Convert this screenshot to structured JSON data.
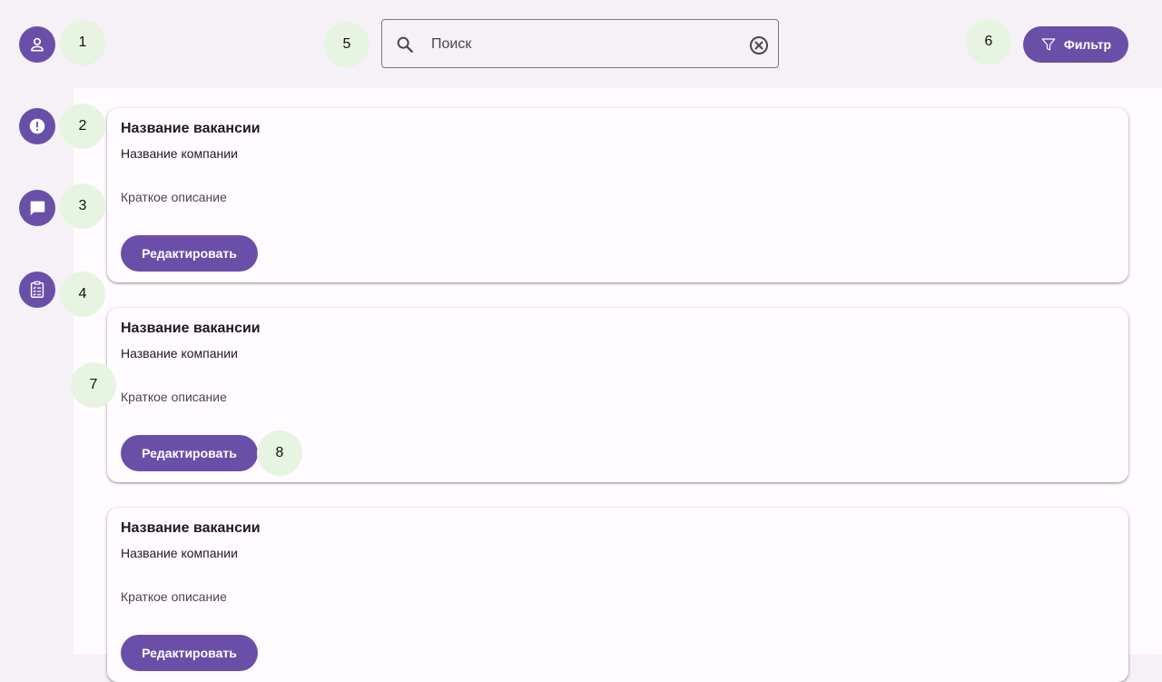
{
  "search": {
    "placeholder": "Поиск",
    "value": ""
  },
  "toolbar": {
    "filter_label": "Фильтр"
  },
  "badges": [
    "1",
    "2",
    "3",
    "4",
    "5",
    "6",
    "7",
    "8"
  ],
  "vacancies": [
    {
      "title": "Название вакансии",
      "company": "Название компании",
      "description": "Краткое описание",
      "edit_label": "Редактировать"
    },
    {
      "title": "Название вакансии",
      "company": "Название компании",
      "description": "Краткое описание",
      "edit_label": "Редактировать"
    },
    {
      "title": "Название вакансии",
      "company": "Название компании",
      "description": "Краткое описание",
      "edit_label": "Редактировать"
    }
  ],
  "colors": {
    "accent": "#6a4fa8",
    "background": "#f5f1f7",
    "surface": "#fffbfe",
    "badge": "#e6f4e1"
  },
  "icons": [
    "profile-icon",
    "alert-icon",
    "chat-icon",
    "clipboard-icon",
    "search-icon",
    "clear-icon",
    "filter-icon"
  ]
}
